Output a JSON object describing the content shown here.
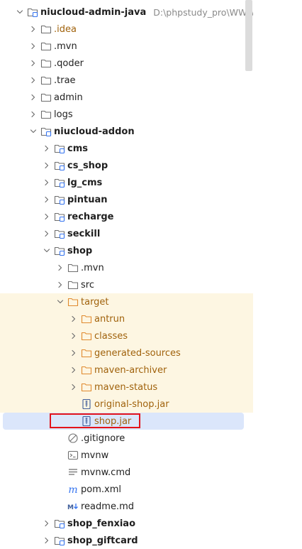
{
  "tree": {
    "rows": [
      {
        "name": "tree-node-niucloud-admin-java",
        "label": "niucloud-admin-java",
        "hint": "D:\\phpstudy_pro\\WWW\\niucloud",
        "depth": 0,
        "expanded": true,
        "icon": "module-folder-icon",
        "bold": true
      },
      {
        "name": "tree-node-idea",
        "label": ".idea",
        "depth": 1,
        "expanded": false,
        "icon": "folder-icon",
        "excluded_text": true
      },
      {
        "name": "tree-node-mvn-root",
        "label": ".mvn",
        "depth": 1,
        "expanded": false,
        "icon": "folder-icon"
      },
      {
        "name": "tree-node-qoder",
        "label": ".qoder",
        "depth": 1,
        "expanded": false,
        "icon": "folder-icon"
      },
      {
        "name": "tree-node-trae",
        "label": ".trae",
        "depth": 1,
        "expanded": false,
        "icon": "folder-icon"
      },
      {
        "name": "tree-node-admin",
        "label": "admin",
        "depth": 1,
        "expanded": false,
        "icon": "folder-icon"
      },
      {
        "name": "tree-node-logs",
        "label": "logs",
        "depth": 1,
        "expanded": false,
        "icon": "folder-icon"
      },
      {
        "name": "tree-node-niucloud-addon",
        "label": "niucloud-addon",
        "depth": 1,
        "expanded": true,
        "icon": "module-folder-icon",
        "bold": true
      },
      {
        "name": "tree-node-cms",
        "label": "cms",
        "depth": 2,
        "expanded": false,
        "icon": "module-folder-icon",
        "bold": true
      },
      {
        "name": "tree-node-cs-shop",
        "label": "cs_shop",
        "depth": 2,
        "expanded": false,
        "icon": "module-folder-icon",
        "bold": true
      },
      {
        "name": "tree-node-lg-cms",
        "label": "lg_cms",
        "depth": 2,
        "expanded": false,
        "icon": "module-folder-icon",
        "bold": true
      },
      {
        "name": "tree-node-pintuan",
        "label": "pintuan",
        "depth": 2,
        "expanded": false,
        "icon": "module-folder-icon",
        "bold": true
      },
      {
        "name": "tree-node-recharge",
        "label": "recharge",
        "depth": 2,
        "expanded": false,
        "icon": "module-folder-icon",
        "bold": true
      },
      {
        "name": "tree-node-seckill",
        "label": "seckill",
        "depth": 2,
        "expanded": false,
        "icon": "module-folder-icon",
        "bold": true
      },
      {
        "name": "tree-node-shop",
        "label": "shop",
        "depth": 2,
        "expanded": true,
        "icon": "module-folder-icon",
        "bold": true
      },
      {
        "name": "tree-node-mvn-shop",
        "label": ".mvn",
        "depth": 3,
        "expanded": false,
        "icon": "folder-icon"
      },
      {
        "name": "tree-node-src",
        "label": "src",
        "depth": 3,
        "expanded": false,
        "icon": "folder-icon"
      },
      {
        "name": "tree-node-target",
        "label": "target",
        "depth": 3,
        "expanded": true,
        "icon": "excluded-folder-icon",
        "excluded": true,
        "excluded_text": true
      },
      {
        "name": "tree-node-antrun",
        "label": "antrun",
        "depth": 4,
        "expanded": false,
        "icon": "excluded-folder-icon",
        "excluded": true,
        "excluded_text": true
      },
      {
        "name": "tree-node-classes",
        "label": "classes",
        "depth": 4,
        "expanded": false,
        "icon": "excluded-folder-icon",
        "excluded": true,
        "excluded_text": true
      },
      {
        "name": "tree-node-generated-sources",
        "label": "generated-sources",
        "depth": 4,
        "expanded": false,
        "icon": "excluded-folder-icon",
        "excluded": true,
        "excluded_text": true
      },
      {
        "name": "tree-node-maven-archiver",
        "label": "maven-archiver",
        "depth": 4,
        "expanded": false,
        "icon": "excluded-folder-icon",
        "excluded": true,
        "excluded_text": true
      },
      {
        "name": "tree-node-maven-status",
        "label": "maven-status",
        "depth": 4,
        "expanded": false,
        "icon": "excluded-folder-icon",
        "excluded": true,
        "excluded_text": true
      },
      {
        "name": "tree-node-original-shop-jar",
        "label": "original-shop.jar",
        "depth": 4,
        "leaf": true,
        "icon": "jar-file-icon",
        "excluded": true,
        "excluded_text": true
      },
      {
        "name": "tree-node-shop-jar",
        "label": "shop.jar",
        "depth": 4,
        "leaf": true,
        "icon": "jar-file-icon",
        "selected": true,
        "excluded_text": true
      },
      {
        "name": "tree-node-gitignore",
        "label": ".gitignore",
        "depth": 3,
        "leaf": true,
        "icon": "ignore-file-icon"
      },
      {
        "name": "tree-node-mvnw",
        "label": "mvnw",
        "depth": 3,
        "leaf": true,
        "icon": "shell-script-icon"
      },
      {
        "name": "tree-node-mvnw-cmd",
        "label": "mvnw.cmd",
        "depth": 3,
        "leaf": true,
        "icon": "text-file-icon"
      },
      {
        "name": "tree-node-pom-xml",
        "label": "pom.xml",
        "depth": 3,
        "leaf": true,
        "icon": "maven-file-icon"
      },
      {
        "name": "tree-node-readme-md",
        "label": "readme.md",
        "depth": 3,
        "leaf": true,
        "icon": "markdown-file-icon"
      },
      {
        "name": "tree-node-shop-fenxiao",
        "label": "shop_fenxiao",
        "depth": 2,
        "expanded": false,
        "icon": "module-folder-icon",
        "bold": true
      },
      {
        "name": "tree-node-shop-giftcard",
        "label": "shop_giftcard",
        "depth": 2,
        "expanded": false,
        "icon": "module-folder-icon",
        "bold": true
      }
    ]
  },
  "colors": {
    "folder_stroke": "#6e6e6e",
    "module_accent": "#3574f0",
    "excluded_folder": "#e08a2e",
    "excluded_text": "#a0620c",
    "selection": "#dbe6fb",
    "excluded_bg": "#fdf6e2",
    "annotation_border": "#e3131b"
  }
}
